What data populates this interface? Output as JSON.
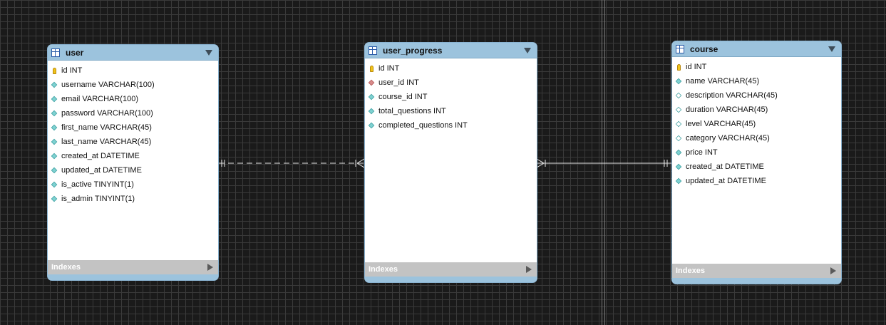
{
  "tables": {
    "user": {
      "name": "user",
      "indexes_label": "Indexes",
      "columns": [
        {
          "text": "id INT",
          "icon": "primary-key-icon"
        },
        {
          "text": "username VARCHAR(100)",
          "icon": "not-null-diamond-icon"
        },
        {
          "text": "email VARCHAR(100)",
          "icon": "not-null-diamond-icon"
        },
        {
          "text": "password VARCHAR(100)",
          "icon": "not-null-diamond-icon"
        },
        {
          "text": "first_name VARCHAR(45)",
          "icon": "not-null-diamond-icon"
        },
        {
          "text": "last_name VARCHAR(45)",
          "icon": "not-null-diamond-icon"
        },
        {
          "text": "created_at DATETIME",
          "icon": "not-null-diamond-icon"
        },
        {
          "text": "updated_at DATETIME",
          "icon": "not-null-diamond-icon"
        },
        {
          "text": "is_active TINYINT(1)",
          "icon": "not-null-diamond-icon"
        },
        {
          "text": "is_admin TINYINT(1)",
          "icon": "not-null-diamond-icon"
        }
      ]
    },
    "user_progress": {
      "name": "user_progress",
      "indexes_label": "Indexes",
      "columns": [
        {
          "text": "id INT",
          "icon": "primary-key-icon"
        },
        {
          "text": "user_id INT",
          "icon": "foreign-key-diamond-icon"
        },
        {
          "text": "course_id INT",
          "icon": "not-null-diamond-icon"
        },
        {
          "text": "total_questions INT",
          "icon": "not-null-diamond-icon"
        },
        {
          "text": "completed_questions INT",
          "icon": "not-null-diamond-icon"
        }
      ]
    },
    "course": {
      "name": "course",
      "indexes_label": "Indexes",
      "columns": [
        {
          "text": "id INT",
          "icon": "primary-key-icon"
        },
        {
          "text": "name VARCHAR(45)",
          "icon": "not-null-diamond-icon"
        },
        {
          "text": "description VARCHAR(45)",
          "icon": "nullable-diamond-icon"
        },
        {
          "text": "duration VARCHAR(45)",
          "icon": "nullable-diamond-icon"
        },
        {
          "text": "level VARCHAR(45)",
          "icon": "nullable-diamond-icon"
        },
        {
          "text": "category VARCHAR(45)",
          "icon": "nullable-diamond-icon"
        },
        {
          "text": "price INT",
          "icon": "not-null-diamond-icon"
        },
        {
          "text": "created_at DATETIME",
          "icon": "not-null-diamond-icon"
        },
        {
          "text": "updated_at DATETIME",
          "icon": "not-null-diamond-icon"
        }
      ]
    }
  },
  "relationships": [
    {
      "from": "user",
      "to": "user_progress",
      "style": "dashed",
      "from_end": "one-and-only-one",
      "to_end": "many"
    },
    {
      "from": "user_progress",
      "to": "course",
      "style": "solid",
      "from_end": "many",
      "to_end": "one-and-only-one"
    }
  ],
  "colors": {
    "canvas": "#1a1a1a",
    "grid": "#3a3a3a",
    "header": "#9cc3dd",
    "indexes_bar": "#c3c3c3",
    "relationship_line": "#e8e8e8"
  }
}
